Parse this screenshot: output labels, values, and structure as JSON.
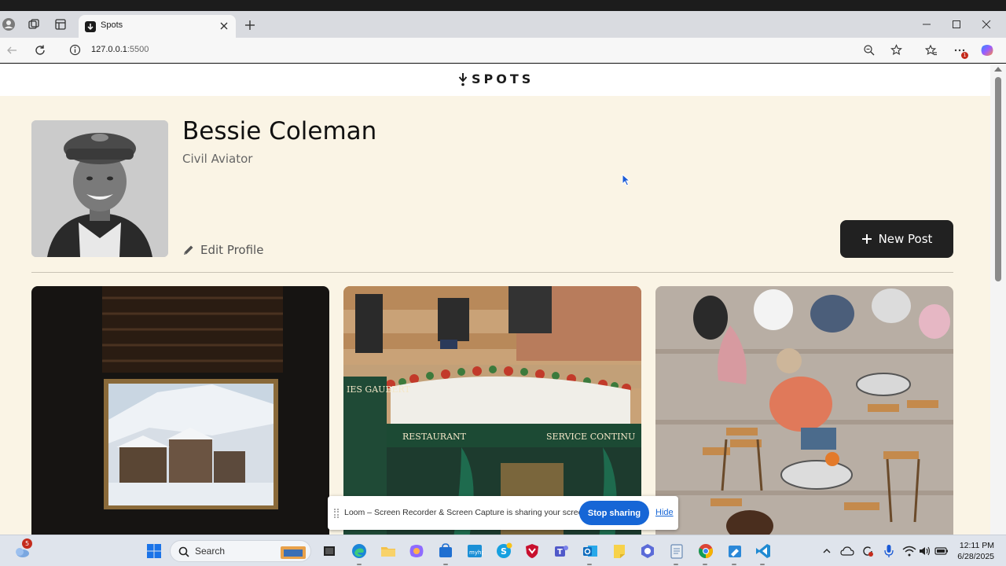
{
  "browser": {
    "tab_title": "Spots",
    "url_host": "127.0.0.1",
    "url_port": ":5500",
    "notification_count": "1"
  },
  "site": {
    "logo_text": "SPOTS"
  },
  "profile": {
    "name": "Bessie Coleman",
    "description": "Civil Aviator",
    "edit_label": "Edit Profile",
    "new_post_label": "New Post"
  },
  "cards": [
    {
      "name": "snowy-village-window-photo"
    },
    {
      "name": "restaurant-storefront-photo"
    },
    {
      "name": "outdoor-cafe-photo"
    }
  ],
  "loom": {
    "message": "Loom – Screen Recorder & Screen Capture is sharing your screen.",
    "stop_label": "Stop sharing",
    "hide_label": "Hide"
  },
  "taskbar": {
    "search_label": "Search",
    "weather_badge": "5",
    "time": "12:11 PM",
    "date": "6/28/2025"
  },
  "colors": {
    "page_bg": "#faf4e5",
    "button_dark": "#212121",
    "loom_blue": "#1666d6"
  }
}
